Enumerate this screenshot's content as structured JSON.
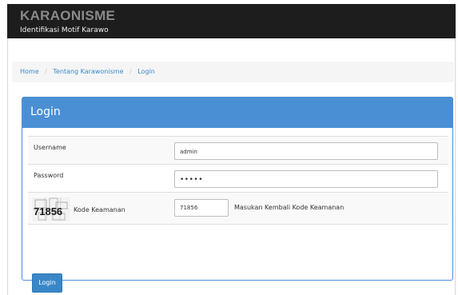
{
  "header": {
    "title": "KARAONISME",
    "subtitle": "Identifikasi Motif Karawo"
  },
  "breadcrumb": {
    "items": [
      "Home",
      "Tentang Karawonisme",
      "Login"
    ],
    "separator": "/"
  },
  "panel": {
    "title": "Login"
  },
  "form": {
    "username_label": "Username",
    "username_value": "admin",
    "password_label": "Password",
    "password_mask": "•••••",
    "captcha_code": "71856",
    "captcha_label": "Kode Keamanan",
    "captcha_input_value": "71856",
    "captcha_hint": "Masukan Kembali Kode Keamanan",
    "submit_label": "Login"
  },
  "colors": {
    "header_bg": "#1d1d1d",
    "primary": "#4a8fd4",
    "button": "#3a87c8",
    "link": "#3a87c8"
  }
}
